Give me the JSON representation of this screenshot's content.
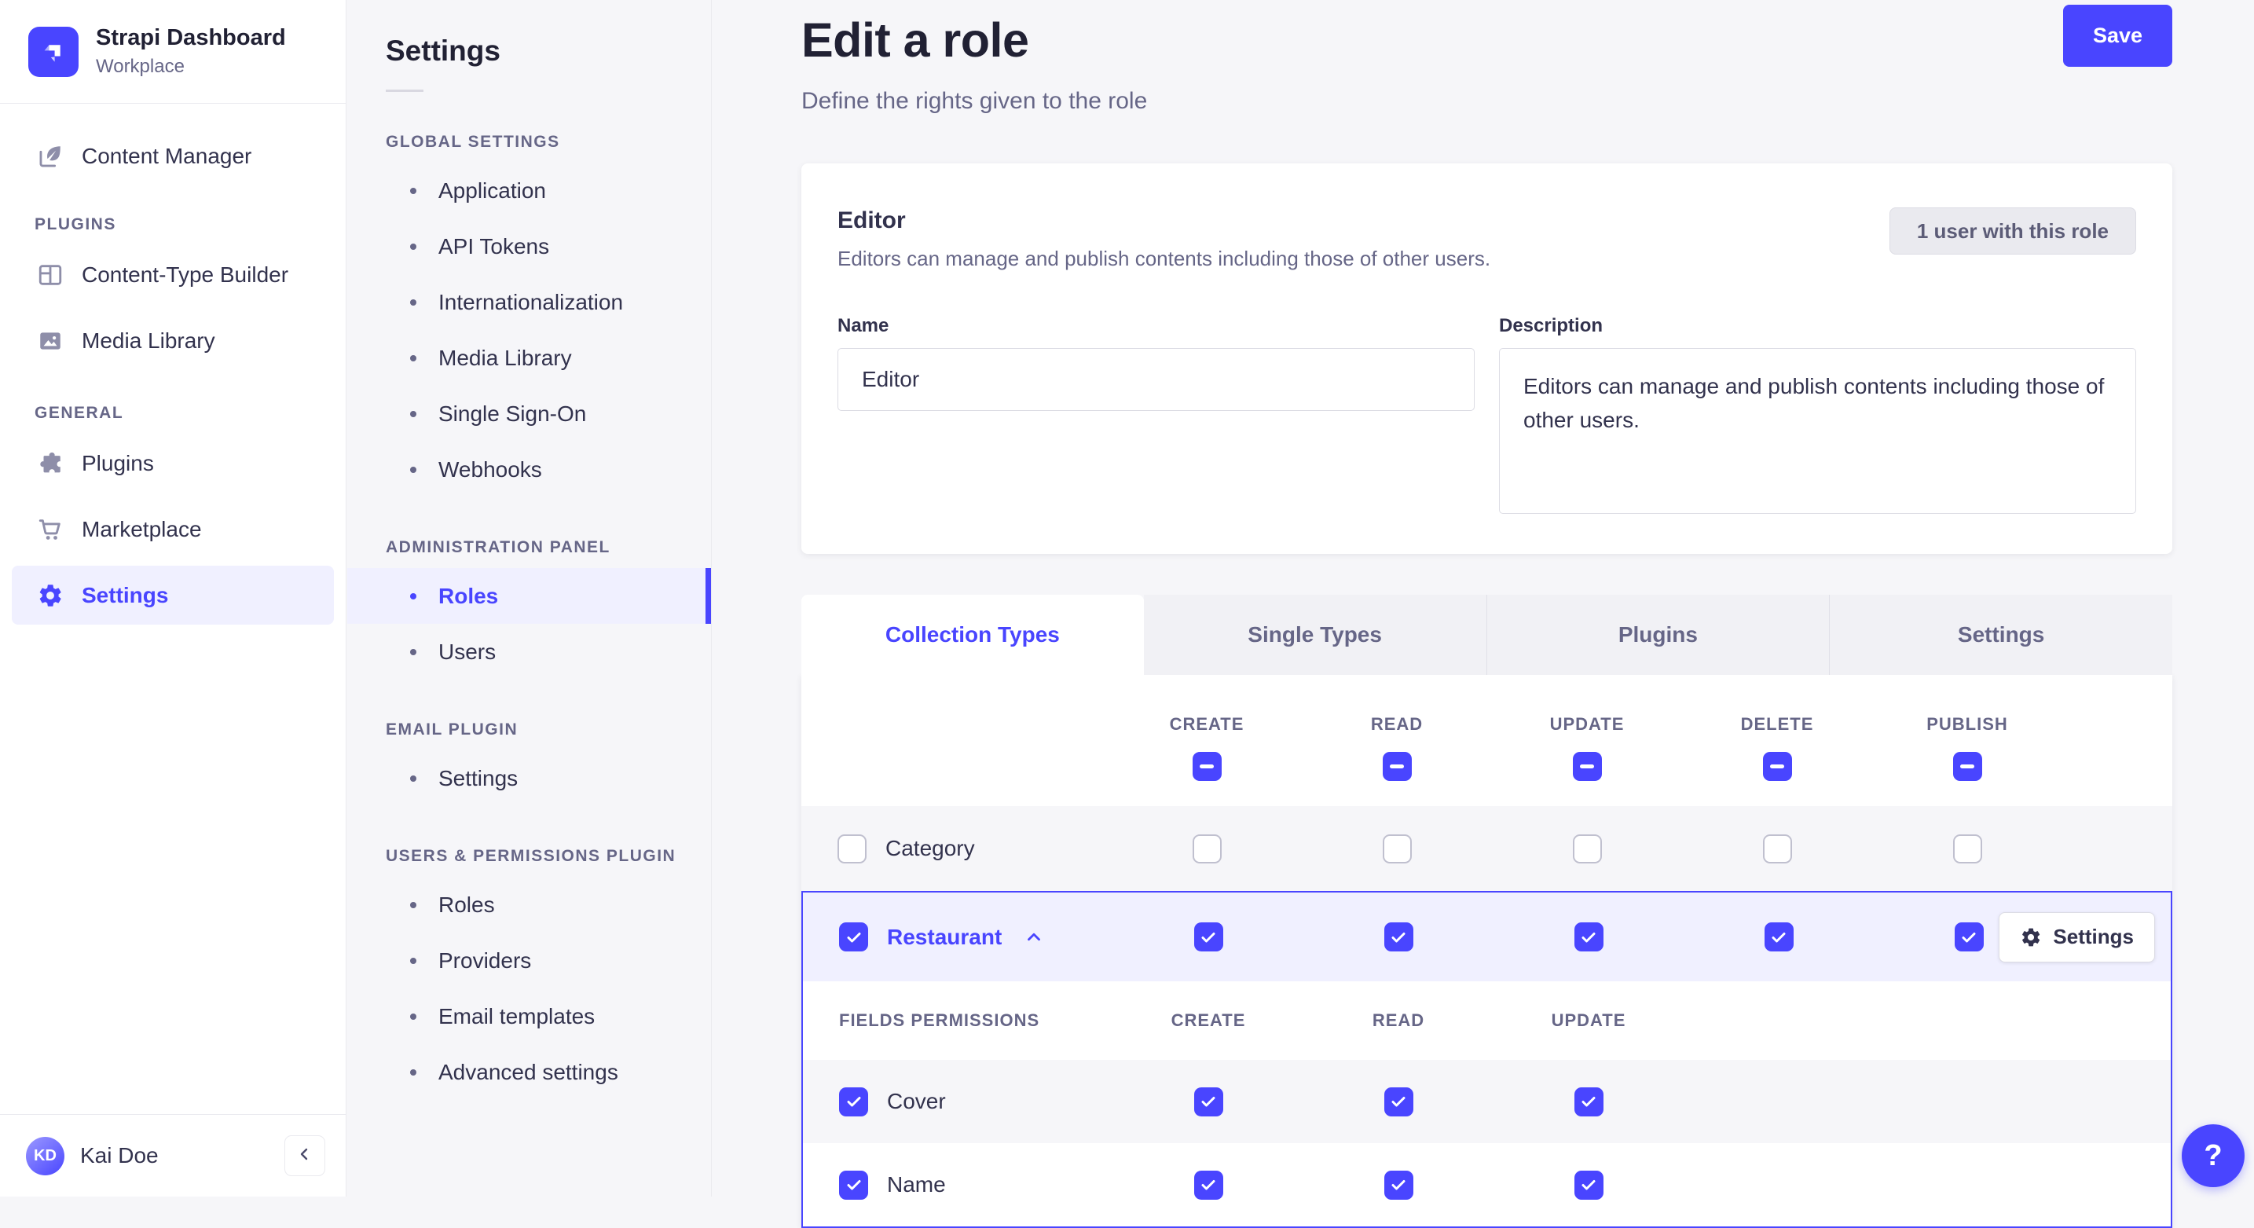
{
  "colors": {
    "accent": "#4945ff",
    "accent_light": "#f0f0ff",
    "text_dark": "#212134",
    "text": "#32324d",
    "muted": "#666687",
    "page_bg": "#f6f6f9"
  },
  "brand": {
    "title": "Strapi Dashboard",
    "subtitle": "Workplace"
  },
  "nav": {
    "content_manager": {
      "label": "Content Manager"
    },
    "sections": [
      {
        "title": "PLUGINS",
        "items": [
          {
            "label": "Content-Type Builder"
          },
          {
            "label": "Media Library"
          }
        ]
      },
      {
        "title": "GENERAL",
        "items": [
          {
            "label": "Plugins"
          },
          {
            "label": "Marketplace"
          },
          {
            "label": "Settings",
            "active": true
          }
        ]
      }
    ],
    "user": {
      "initials": "KD",
      "name": "Kai Doe"
    }
  },
  "subnav": {
    "title": "Settings",
    "sections": [
      {
        "title": "GLOBAL SETTINGS",
        "items": [
          {
            "label": "Application"
          },
          {
            "label": "API Tokens"
          },
          {
            "label": "Internationalization"
          },
          {
            "label": "Media Library"
          },
          {
            "label": "Single Sign-On"
          },
          {
            "label": "Webhooks"
          }
        ]
      },
      {
        "title": "ADMINISTRATION PANEL",
        "items": [
          {
            "label": "Roles",
            "active": true
          },
          {
            "label": "Users"
          }
        ]
      },
      {
        "title": "EMAIL PLUGIN",
        "items": [
          {
            "label": "Settings"
          }
        ]
      },
      {
        "title": "USERS & PERMISSIONS PLUGIN",
        "items": [
          {
            "label": "Roles"
          },
          {
            "label": "Providers"
          },
          {
            "label": "Email templates"
          },
          {
            "label": "Advanced settings"
          }
        ]
      }
    ]
  },
  "header": {
    "title": "Edit a role",
    "subtitle": "Define the rights given to the role",
    "save_label": "Save"
  },
  "role_card": {
    "name": "Editor",
    "description": "Editors can manage and publish contents including those of other users.",
    "users_button": "1 user with this role",
    "name_label": "Name",
    "name_value": "Editor",
    "description_label": "Description",
    "description_value": "Editors can manage and publish contents including those of other users."
  },
  "permissions": {
    "tabs": [
      {
        "label": "Collection Types",
        "active": true
      },
      {
        "label": "Single Types",
        "active": false
      },
      {
        "label": "Plugins",
        "active": false
      },
      {
        "label": "Settings",
        "active": false
      }
    ],
    "columns": [
      "CREATE",
      "READ",
      "UPDATE",
      "DELETE",
      "PUBLISH"
    ],
    "select_all_states": [
      "indeterminate",
      "indeterminate",
      "indeterminate",
      "indeterminate",
      "indeterminate"
    ],
    "rows": [
      {
        "label": "Category",
        "state": "unchecked",
        "expanded": false,
        "cells": [
          "unchecked",
          "unchecked",
          "unchecked",
          "unchecked",
          "unchecked"
        ]
      },
      {
        "label": "Restaurant",
        "state": "checked",
        "expanded": true,
        "settings_label": "Settings",
        "cells": [
          "checked",
          "checked",
          "checked",
          "checked",
          "checked"
        ]
      }
    ],
    "fields_section": {
      "title": "FIELDS PERMISSIONS",
      "columns": [
        "CREATE",
        "READ",
        "UPDATE"
      ],
      "rows": [
        {
          "label": "Cover",
          "state": "checked",
          "cells": [
            "checked",
            "checked",
            "checked"
          ]
        },
        {
          "label": "Name",
          "state": "checked",
          "cells": [
            "checked",
            "checked",
            "checked"
          ]
        }
      ]
    }
  },
  "help_button": {
    "label": "?"
  }
}
